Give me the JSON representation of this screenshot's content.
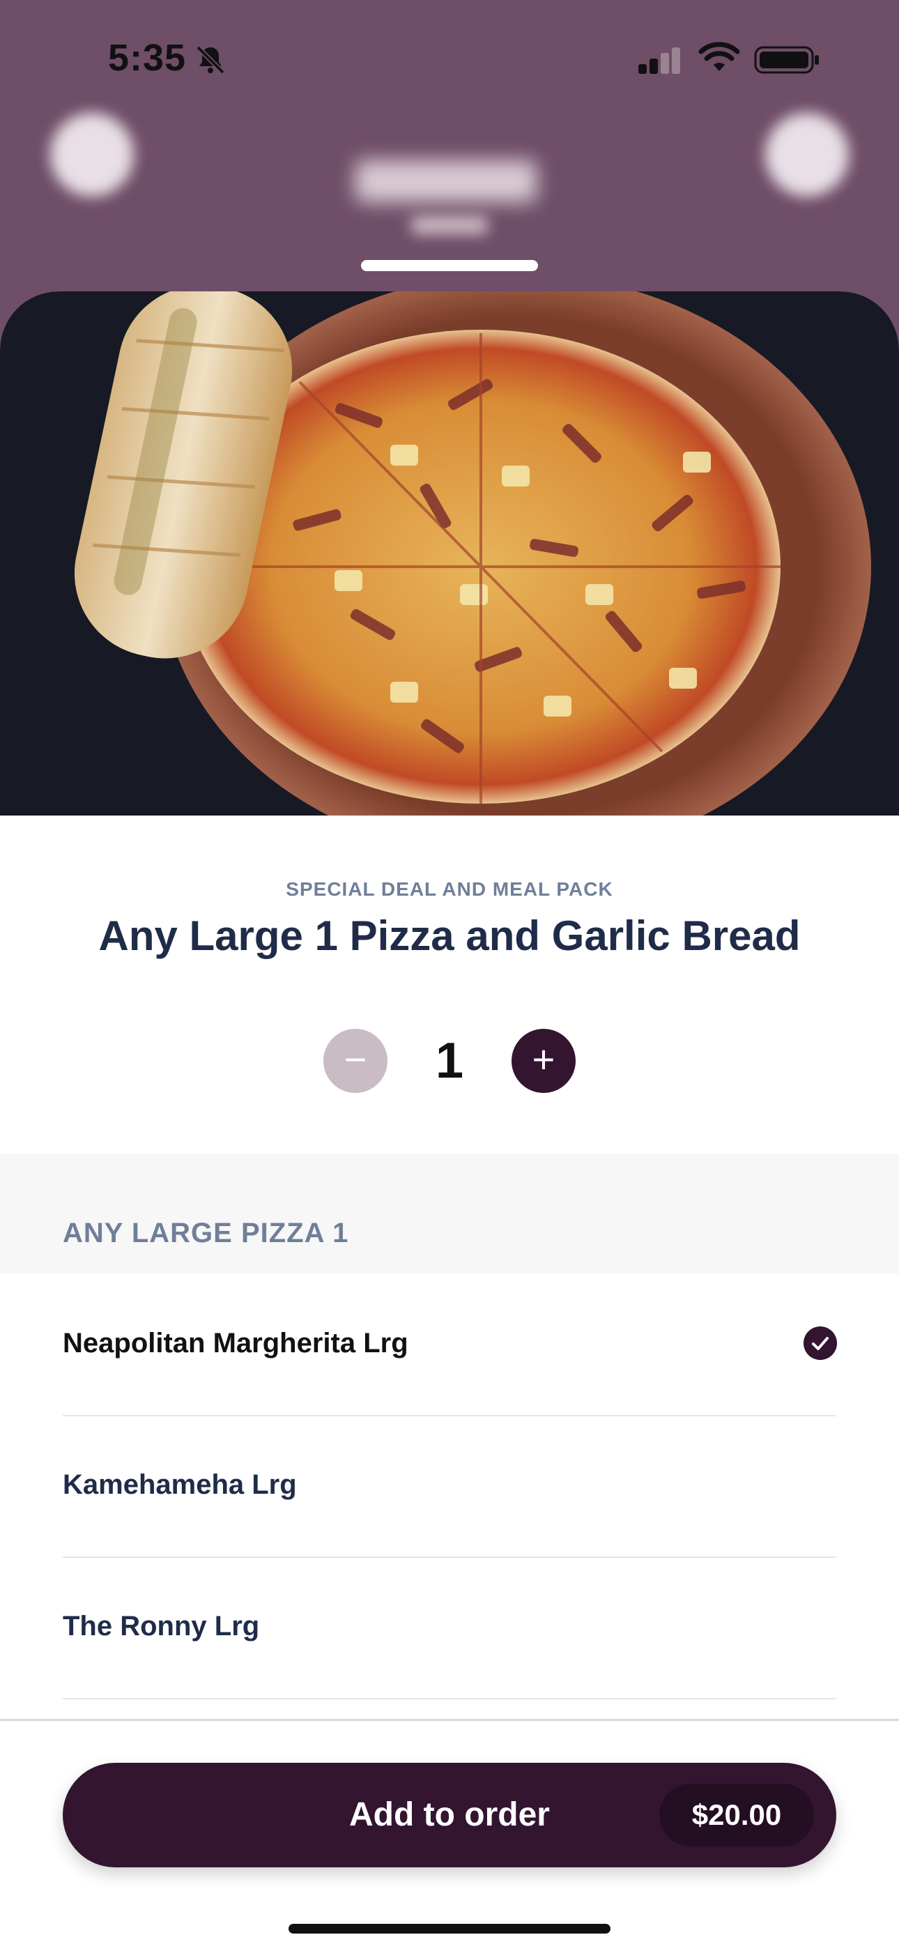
{
  "status_bar": {
    "time": "5:35",
    "icons": [
      "bell-slash-icon",
      "cellular-signal-icon",
      "wifi-icon",
      "battery-icon"
    ]
  },
  "colors": {
    "header_bg": "#6f4e67",
    "accent": "#331530",
    "title": "#1f2c49",
    "muted": "#6f7f99"
  },
  "product": {
    "category": "SPECIAL DEAL AND MEAL PACK",
    "title": "Any Large 1 Pizza and Garlic Bread",
    "image_alt": "pizza-with-garlic-bread-photo"
  },
  "quantity": {
    "minus": "−",
    "value": "1",
    "plus": "+"
  },
  "section": {
    "title": "ANY LARGE PIZZA 1",
    "options": [
      {
        "label": "Neapolitan Margherita Lrg",
        "selected": true
      },
      {
        "label": "Kamehameha Lrg",
        "selected": false
      },
      {
        "label": "The Ronny Lrg",
        "selected": false
      }
    ]
  },
  "order_button": {
    "label": "Add to order",
    "price": "$20.00"
  }
}
